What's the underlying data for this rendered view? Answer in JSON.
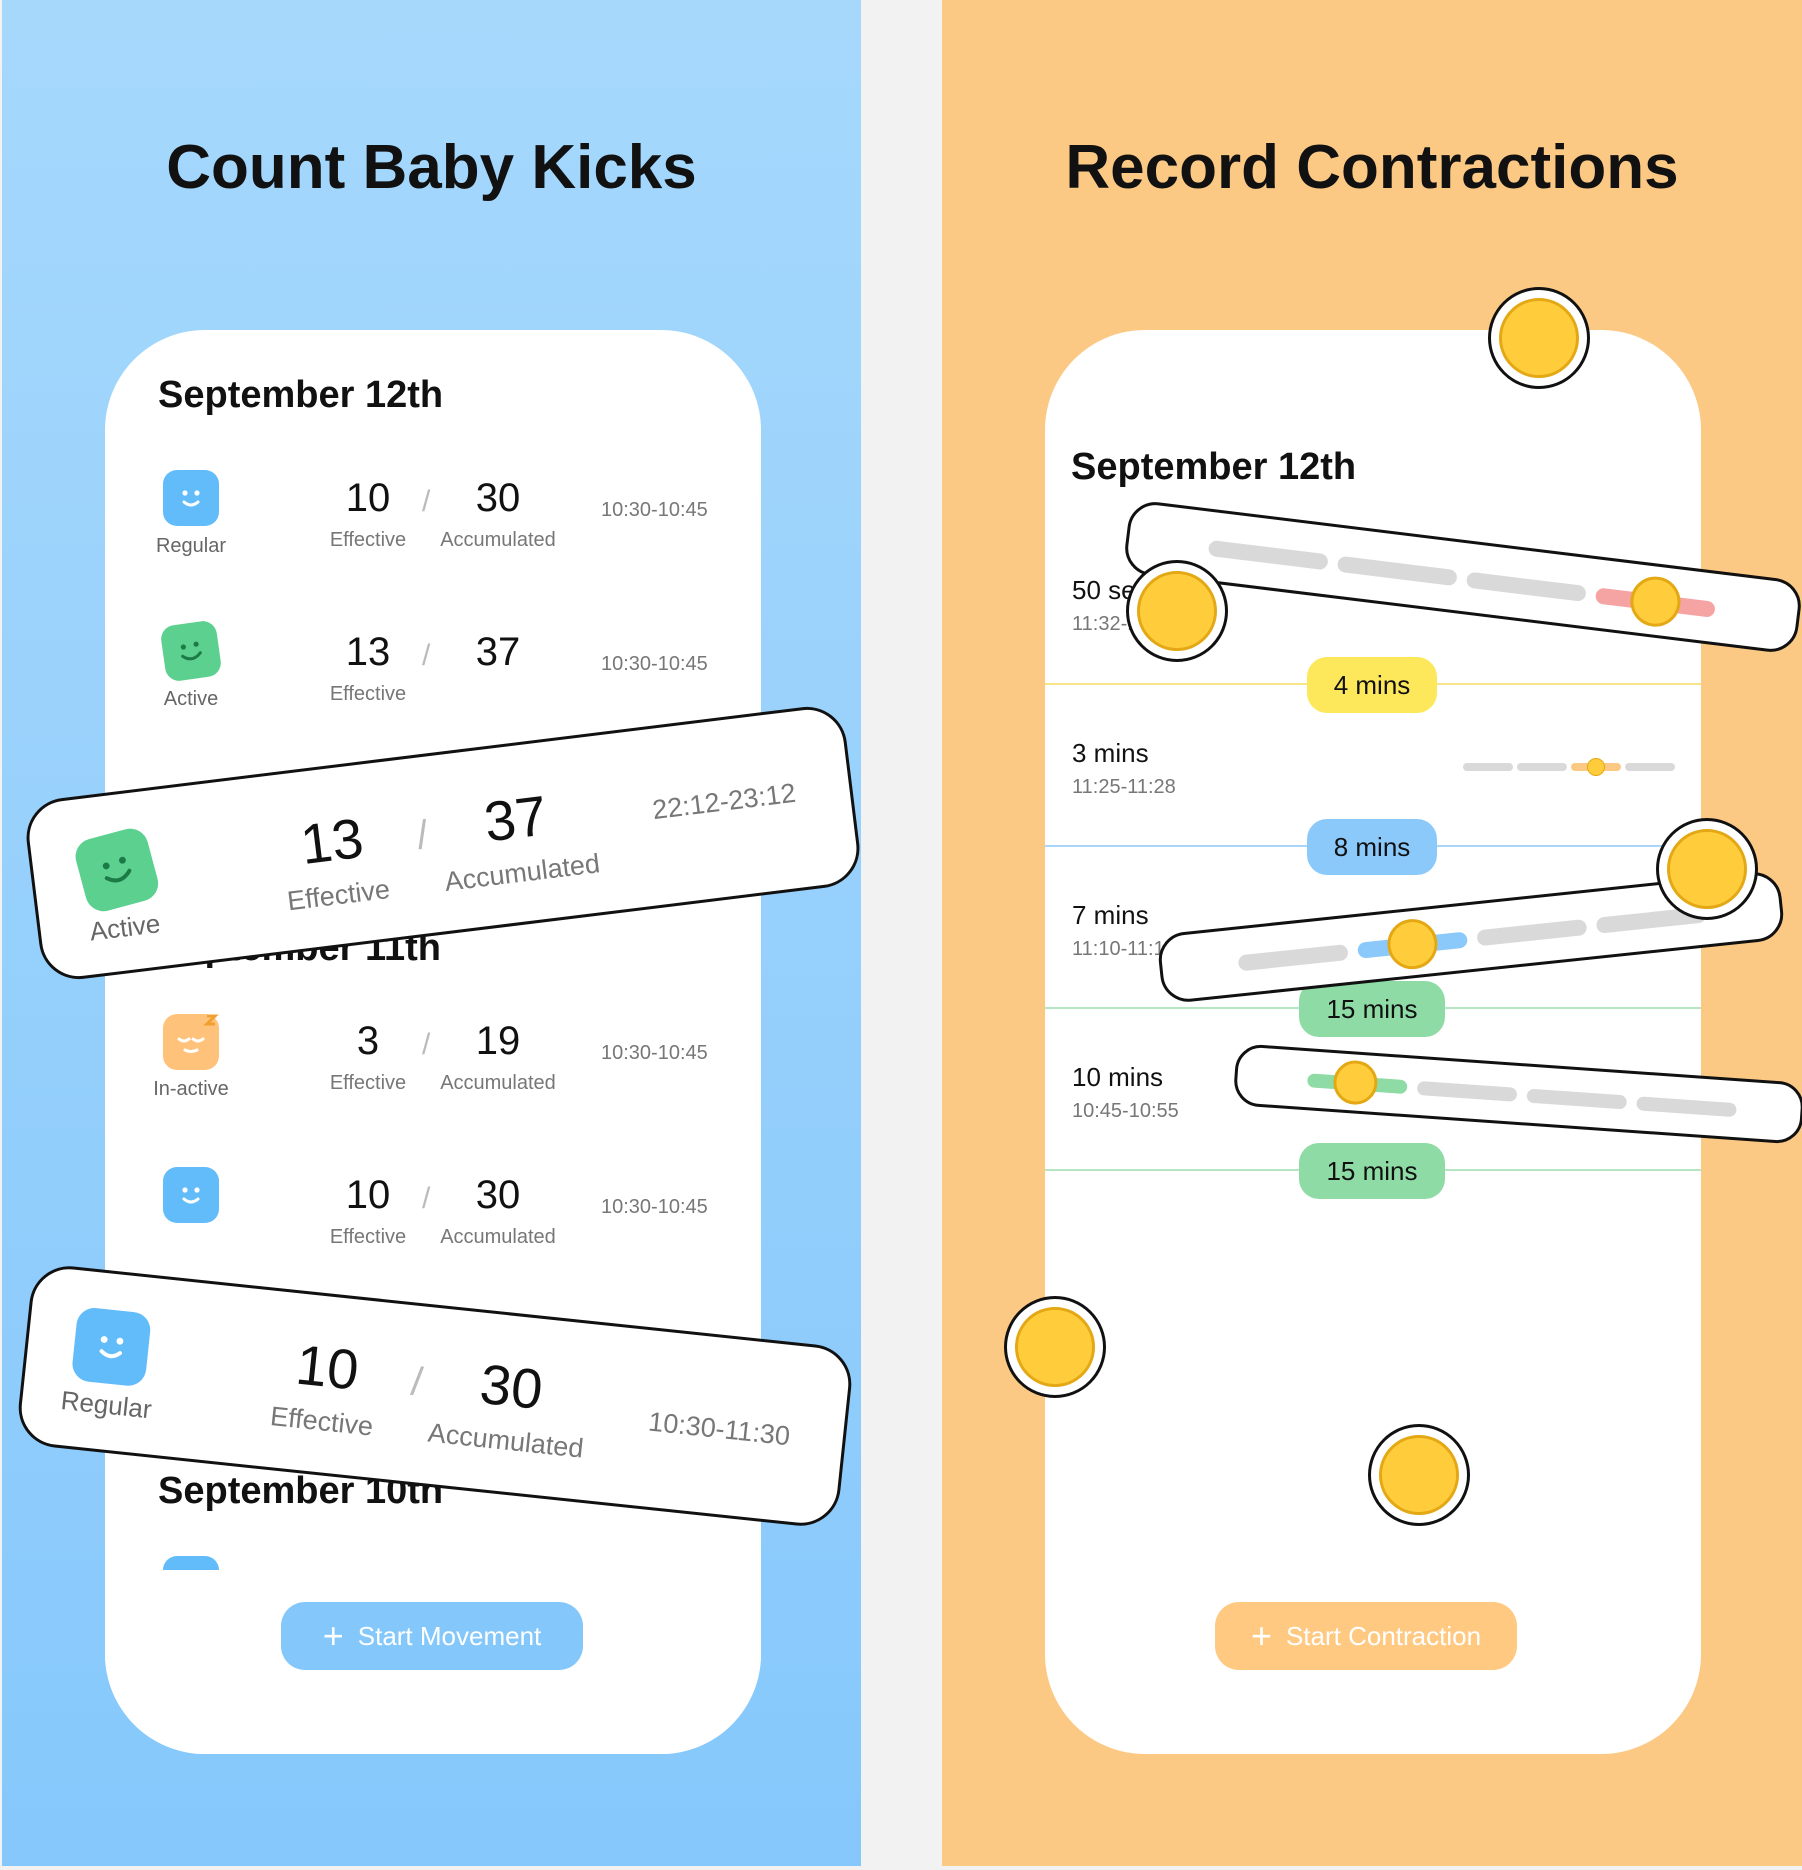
{
  "left": {
    "headline": "Count Baby Kicks",
    "sections": [
      {
        "date": "September 12th"
      },
      {
        "date": "September 11th"
      },
      {
        "date": "September 10th"
      }
    ],
    "rows": [
      {
        "mood": "Regular",
        "effective": "10",
        "accumulated": "30",
        "time": "10:30-10:45"
      },
      {
        "mood": "Active",
        "effective": "13",
        "accumulated": "37",
        "time": "10:30-10:45"
      },
      {
        "mood": "In-active",
        "effective": "3",
        "accumulated": "19",
        "time": "10:30-10:45"
      },
      {
        "mood": "",
        "effective": "10",
        "accumulated": "30",
        "time": "10:30-10:45"
      }
    ],
    "label_effective": "Effective",
    "label_accumulated": "Accumulated",
    "slash": "/",
    "card_active": {
      "mood": "Active",
      "effective": "13",
      "accumulated": "37",
      "time": "22:12-23:12"
    },
    "card_regular": {
      "mood": "Regular",
      "effective": "10",
      "accumulated": "30",
      "time": "10:30-11:30"
    },
    "start_button": "Start Movement",
    "plus": "+",
    "colors": {
      "accent": "#83c7fb",
      "regular": "#63bcfa",
      "active": "#5cd08f",
      "inactive": "#ffc27a"
    }
  },
  "right": {
    "headline": "Record Contractions",
    "date": "September 12th",
    "entries": [
      {
        "duration": "50 se",
        "range": "11:32-1"
      },
      {
        "duration": "3 mins",
        "range": "11:25-11:28"
      },
      {
        "duration": "7 mins",
        "range": "11:10-11:17"
      },
      {
        "duration": "10 mins",
        "range": "10:45-10:55"
      }
    ],
    "intervals": [
      {
        "label": "4 mins",
        "color": "#fde75a"
      },
      {
        "label": "8 mins",
        "color": "#8cc9fb"
      },
      {
        "label": "15 mins",
        "color": "#8fdba6"
      },
      {
        "label": "15 mins",
        "color": "#8fdba6"
      }
    ],
    "start_button": "Start Contraction",
    "plus": "+",
    "colors": {
      "accent": "#ffc982",
      "pain": "#f5a3a3",
      "calm": "#8fdba6",
      "mild": "#8cc9fb"
    },
    "emoji_icons": [
      "tired-face-icon",
      "confounded-face-icon",
      "relieved-face-icon",
      "sad-face-icon",
      "sleepy-face-icon"
    ]
  }
}
